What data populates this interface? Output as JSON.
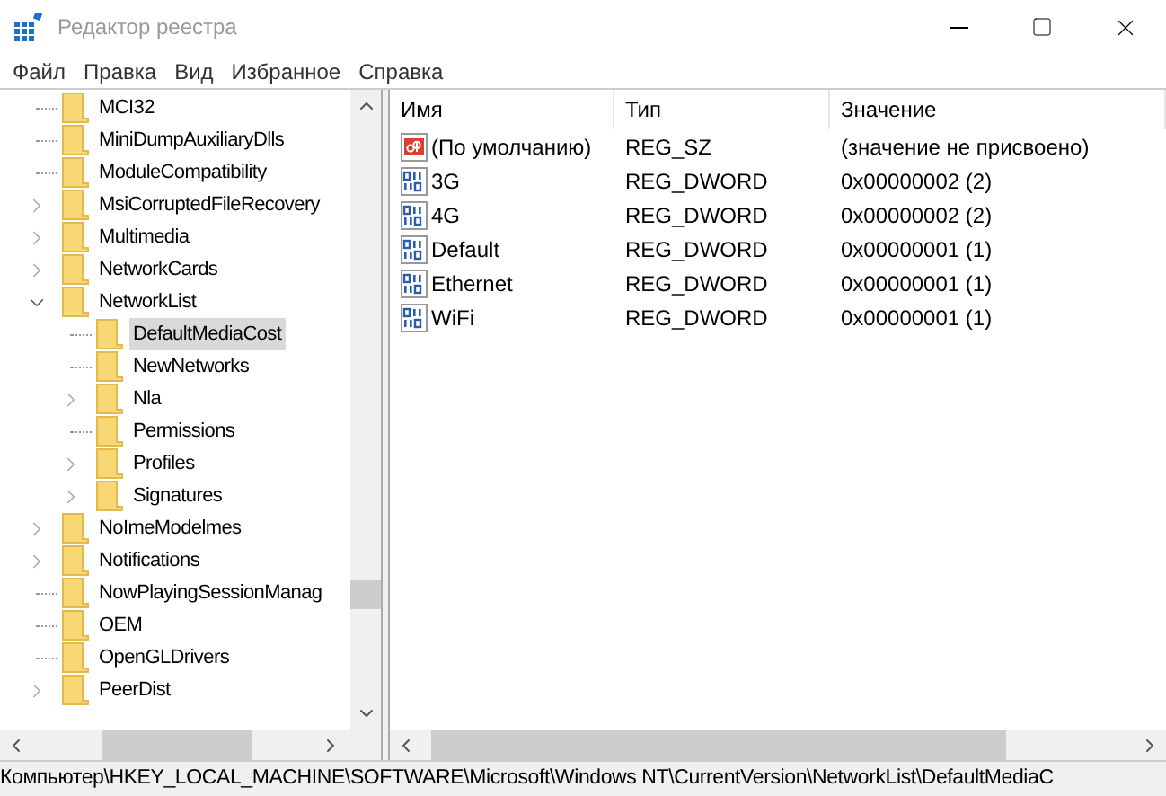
{
  "window": {
    "title": "Редактор реестра"
  },
  "menu": [
    "Файл",
    "Правка",
    "Вид",
    "Избранное",
    "Справка"
  ],
  "tree": [
    {
      "label": "MCI32",
      "selected": false
    },
    {
      "label": "MiniDumpAuxiliaryDlls",
      "selected": false
    },
    {
      "label": "ModuleCompatibility",
      "selected": false
    },
    {
      "label": "MsiCorruptedFileRecovery",
      "selected": false,
      "expanded": false
    },
    {
      "label": "Multimedia",
      "selected": false,
      "expanded": false
    },
    {
      "label": "NetworkCards",
      "selected": false,
      "expanded": false
    },
    {
      "label": "NetworkList",
      "selected": false,
      "expanded": true,
      "children": [
        {
          "label": "DefaultMediaCost",
          "selected": true
        },
        {
          "label": "NewNetworks",
          "selected": false
        },
        {
          "label": "Nla",
          "selected": false,
          "expanded": false
        },
        {
          "label": "Permissions",
          "selected": false
        },
        {
          "label": "Profiles",
          "selected": false,
          "expanded": false
        },
        {
          "label": "Signatures",
          "selected": false,
          "expanded": false
        }
      ]
    },
    {
      "label": "NoImeModelmes",
      "selected": false,
      "expanded": false
    },
    {
      "label": "Notifications",
      "selected": false,
      "expanded": false
    },
    {
      "label": "NowPlayingSessionManag",
      "selected": false
    },
    {
      "label": "OEM",
      "selected": false
    },
    {
      "label": "OpenGLDrivers",
      "selected": false
    },
    {
      "label": "PeerDist",
      "selected": false,
      "expanded": false
    }
  ],
  "values": {
    "columns": [
      "Имя",
      "Тип",
      "Значение"
    ],
    "rows": [
      {
        "kind": "string",
        "name": "(По умолчанию)",
        "type": "REG_SZ",
        "data": "(значение не присвоено)"
      },
      {
        "kind": "dword",
        "name": "3G",
        "type": "REG_DWORD",
        "data": "0x00000002 (2)"
      },
      {
        "kind": "dword",
        "name": "4G",
        "type": "REG_DWORD",
        "data": "0x00000002 (2)"
      },
      {
        "kind": "dword",
        "name": "Default",
        "type": "REG_DWORD",
        "data": "0x00000001 (1)"
      },
      {
        "kind": "dword",
        "name": "Ethernet",
        "type": "REG_DWORD",
        "data": "0x00000001 (1)"
      },
      {
        "kind": "dword",
        "name": "WiFi",
        "type": "REG_DWORD",
        "data": "0x00000001 (1)"
      }
    ]
  },
  "status_bar": "Компьютер\\HKEY_LOCAL_MACHINE\\SOFTWARE\\Microsoft\\Windows NT\\CurrentVersion\\NetworkList\\DefaultMediaC"
}
